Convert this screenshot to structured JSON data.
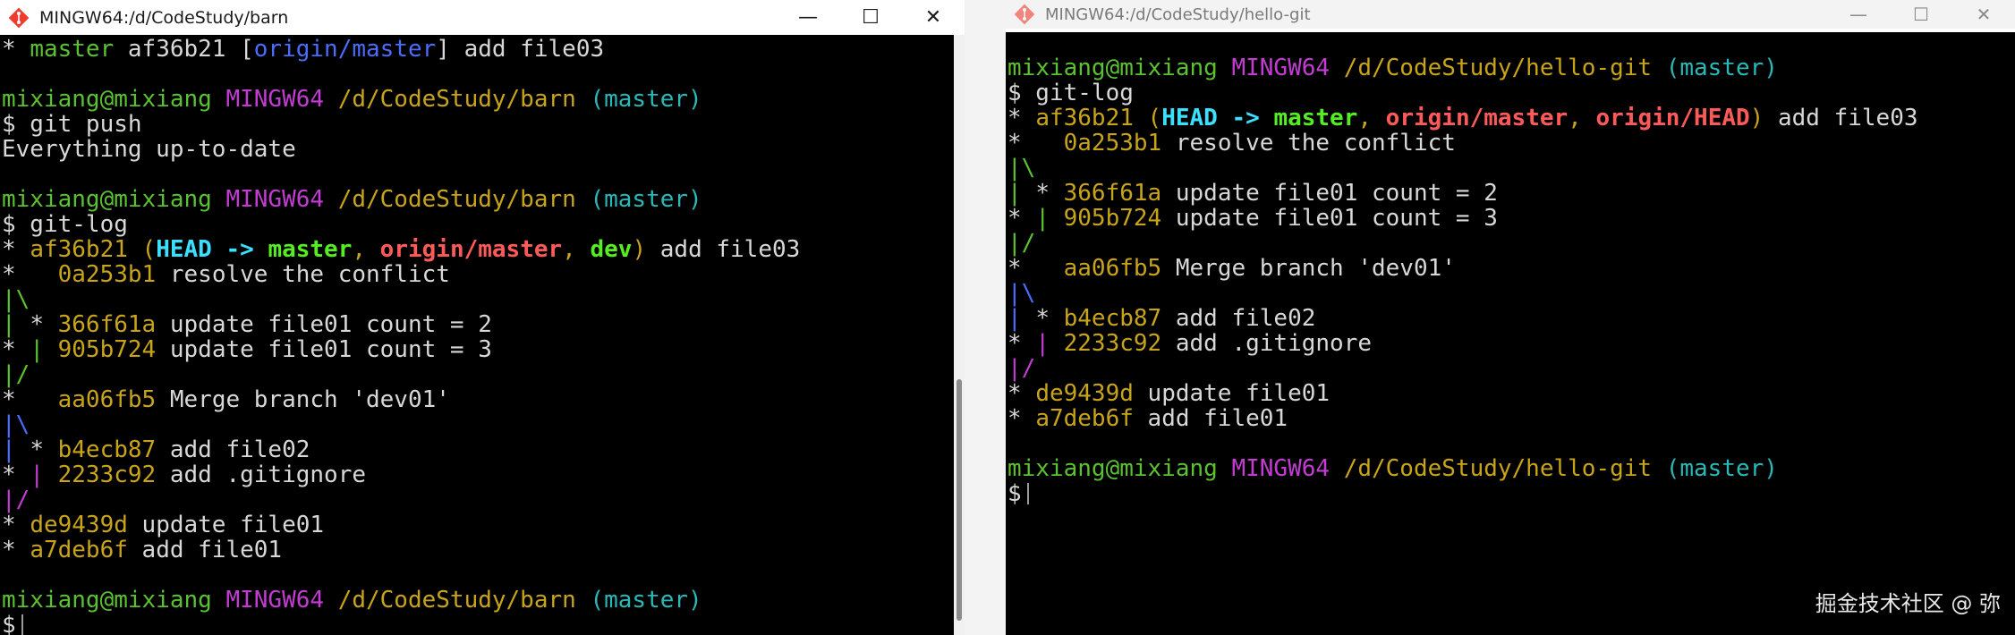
{
  "colors": {
    "white": "#d8d8d8",
    "green": "#5ac230",
    "magenta": "#c23cd2",
    "yellow": "#c8a41a",
    "cyan": "#2ab8b8",
    "blue": "#4a6cff",
    "bold_cyan": "#3ce0ff",
    "bold_green": "#55ee22",
    "bold_red": "#ff5a5a",
    "watermark": "#e8e8e8"
  },
  "watermark": "掘金技术社区 @ 弥𡿩",
  "left": {
    "title": "MINGW64:/d/CodeStudy/barn",
    "lines": [
      [
        [
          "* ",
          "white"
        ],
        [
          "master",
          "green"
        ],
        [
          " af36b21 [",
          "white"
        ],
        [
          "origin/master",
          "blue"
        ],
        [
          "] add file03",
          "white"
        ]
      ],
      [],
      [
        [
          "mixiang@mixiang ",
          "green"
        ],
        [
          "MINGW64 ",
          "magenta"
        ],
        [
          "/d/CodeStudy/barn ",
          "yellow"
        ],
        [
          "(master)",
          "cyan"
        ]
      ],
      [
        [
          "$ git push",
          "white"
        ]
      ],
      [
        [
          "Everything up-to-date",
          "white"
        ]
      ],
      [],
      [
        [
          "mixiang@mixiang ",
          "green"
        ],
        [
          "MINGW64 ",
          "magenta"
        ],
        [
          "/d/CodeStudy/barn ",
          "yellow"
        ],
        [
          "(master)",
          "cyan"
        ]
      ],
      [
        [
          "$ git-log",
          "white"
        ]
      ],
      [
        [
          "* ",
          "white"
        ],
        [
          "af36b21 (",
          "yellow"
        ],
        [
          "HEAD -> ",
          "bold_cyan"
        ],
        [
          "master",
          "bold_green"
        ],
        [
          ", ",
          "yellow"
        ],
        [
          "origin/master",
          "bold_red"
        ],
        [
          ", ",
          "yellow"
        ],
        [
          "dev",
          "bold_green"
        ],
        [
          ")",
          "yellow"
        ],
        [
          " add file03",
          "white"
        ]
      ],
      [
        [
          "*   ",
          "white"
        ],
        [
          "0a253b1",
          "yellow"
        ],
        [
          " resolve the conflict",
          "white"
        ]
      ],
      [
        [
          "|\\",
          "green"
        ]
      ],
      [
        [
          "| ",
          "green"
        ],
        [
          "* ",
          "white"
        ],
        [
          "366f61a",
          "yellow"
        ],
        [
          " update file01 count = 2",
          "white"
        ]
      ],
      [
        [
          "* ",
          "white"
        ],
        [
          "| ",
          "green"
        ],
        [
          "905b724",
          "yellow"
        ],
        [
          " update file01 count = 3",
          "white"
        ]
      ],
      [
        [
          "|/",
          "green"
        ]
      ],
      [
        [
          "*   ",
          "white"
        ],
        [
          "aa06fb5",
          "yellow"
        ],
        [
          " Merge branch 'dev01'",
          "white"
        ]
      ],
      [
        [
          "|\\",
          "blue"
        ]
      ],
      [
        [
          "| ",
          "blue"
        ],
        [
          "* ",
          "white"
        ],
        [
          "b4ecb87",
          "yellow"
        ],
        [
          " add file02",
          "white"
        ]
      ],
      [
        [
          "* ",
          "white"
        ],
        [
          "| ",
          "magenta"
        ],
        [
          "2233c92",
          "yellow"
        ],
        [
          " add .gitignore",
          "white"
        ]
      ],
      [
        [
          "|/",
          "magenta"
        ]
      ],
      [
        [
          "* ",
          "white"
        ],
        [
          "de9439d",
          "yellow"
        ],
        [
          " update file01",
          "white"
        ]
      ],
      [
        [
          "* ",
          "white"
        ],
        [
          "a7deb6f",
          "yellow"
        ],
        [
          " add file01",
          "white"
        ]
      ],
      [],
      [
        [
          "mixiang@mixiang ",
          "green"
        ],
        [
          "MINGW64 ",
          "magenta"
        ],
        [
          "/d/CodeStudy/barn ",
          "yellow"
        ],
        [
          "(master)",
          "cyan"
        ]
      ],
      [
        [
          "$",
          "white"
        ]
      ]
    ]
  },
  "right": {
    "title": "MINGW64:/d/CodeStudy/hello-git",
    "lines": [
      [
        [
          "mixiang@mixiang ",
          "green"
        ],
        [
          "MINGW64 ",
          "magenta"
        ],
        [
          "/d/CodeStudy/hello-git ",
          "yellow"
        ],
        [
          "(master)",
          "cyan"
        ]
      ],
      [
        [
          "$ git-log",
          "white"
        ]
      ],
      [
        [
          "* ",
          "white"
        ],
        [
          "af36b21 (",
          "yellow"
        ],
        [
          "HEAD -> ",
          "bold_cyan"
        ],
        [
          "master",
          "bold_green"
        ],
        [
          ", ",
          "yellow"
        ],
        [
          "origin/master",
          "bold_red"
        ],
        [
          ", ",
          "yellow"
        ],
        [
          "origin/HEAD",
          "bold_red"
        ],
        [
          ")",
          "yellow"
        ],
        [
          " add file03",
          "white"
        ]
      ],
      [
        [
          "*   ",
          "white"
        ],
        [
          "0a253b1",
          "yellow"
        ],
        [
          " resolve the conflict",
          "white"
        ]
      ],
      [
        [
          "|\\",
          "green"
        ]
      ],
      [
        [
          "| ",
          "green"
        ],
        [
          "* ",
          "white"
        ],
        [
          "366f61a",
          "yellow"
        ],
        [
          " update file01 count = 2",
          "white"
        ]
      ],
      [
        [
          "* ",
          "white"
        ],
        [
          "| ",
          "green"
        ],
        [
          "905b724",
          "yellow"
        ],
        [
          " update file01 count = 3",
          "white"
        ]
      ],
      [
        [
          "|/",
          "green"
        ]
      ],
      [
        [
          "*   ",
          "white"
        ],
        [
          "aa06fb5",
          "yellow"
        ],
        [
          " Merge branch 'dev01'",
          "white"
        ]
      ],
      [
        [
          "|\\",
          "blue"
        ]
      ],
      [
        [
          "| ",
          "blue"
        ],
        [
          "* ",
          "white"
        ],
        [
          "b4ecb87",
          "yellow"
        ],
        [
          " add file02",
          "white"
        ]
      ],
      [
        [
          "* ",
          "white"
        ],
        [
          "| ",
          "magenta"
        ],
        [
          "2233c92",
          "yellow"
        ],
        [
          " add .gitignore",
          "white"
        ]
      ],
      [
        [
          "|/",
          "magenta"
        ]
      ],
      [
        [
          "* ",
          "white"
        ],
        [
          "de9439d",
          "yellow"
        ],
        [
          " update file01",
          "white"
        ]
      ],
      [
        [
          "* ",
          "white"
        ],
        [
          "a7deb6f",
          "yellow"
        ],
        [
          " add file01",
          "white"
        ]
      ],
      [],
      [
        [
          "mixiang@mixiang ",
          "green"
        ],
        [
          "MINGW64 ",
          "magenta"
        ],
        [
          "/d/CodeStudy/hello-git ",
          "yellow"
        ],
        [
          "(master)",
          "cyan"
        ]
      ],
      [
        [
          "$",
          "white"
        ]
      ]
    ]
  }
}
